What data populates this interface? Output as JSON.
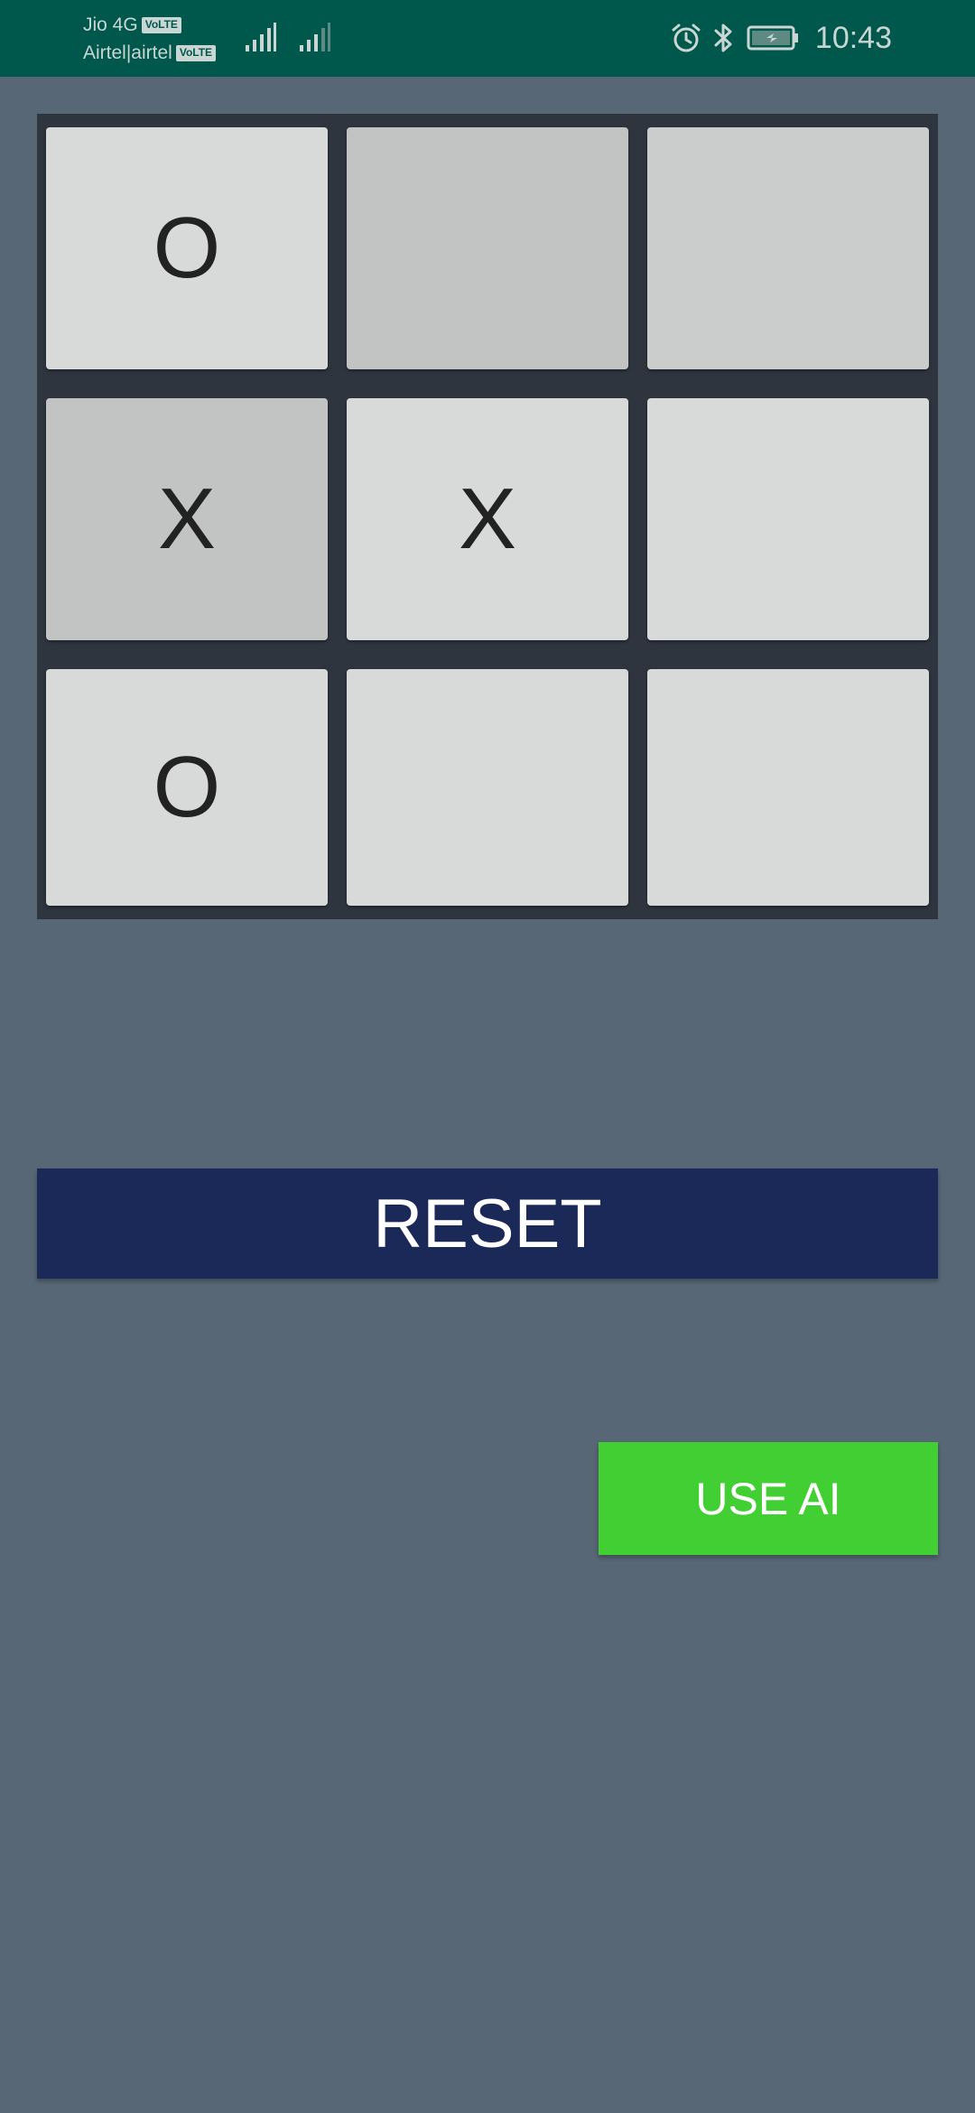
{
  "status_bar": {
    "carrier_1": "Jio 4G",
    "carrier_1_badge": "VoLTE",
    "carrier_2": "Airtel|airtel",
    "carrier_2_badge": "VoLTE",
    "time": "10:43",
    "icons": [
      "signal-icon",
      "signal-icon",
      "alarm-icon",
      "bluetooth-icon",
      "battery-charging-icon"
    ],
    "background_color": "#00574b"
  },
  "board": {
    "background_color": "#2e353f",
    "cells": [
      [
        "O",
        "",
        ""
      ],
      [
        "X",
        "X",
        ""
      ],
      [
        "O",
        "",
        ""
      ]
    ]
  },
  "controls": {
    "reset_label": "RESET",
    "reset_color": "#1a2957",
    "use_ai_label": "USE AI",
    "use_ai_color": "#42cf33"
  },
  "page": {
    "background_color": "#586776"
  }
}
